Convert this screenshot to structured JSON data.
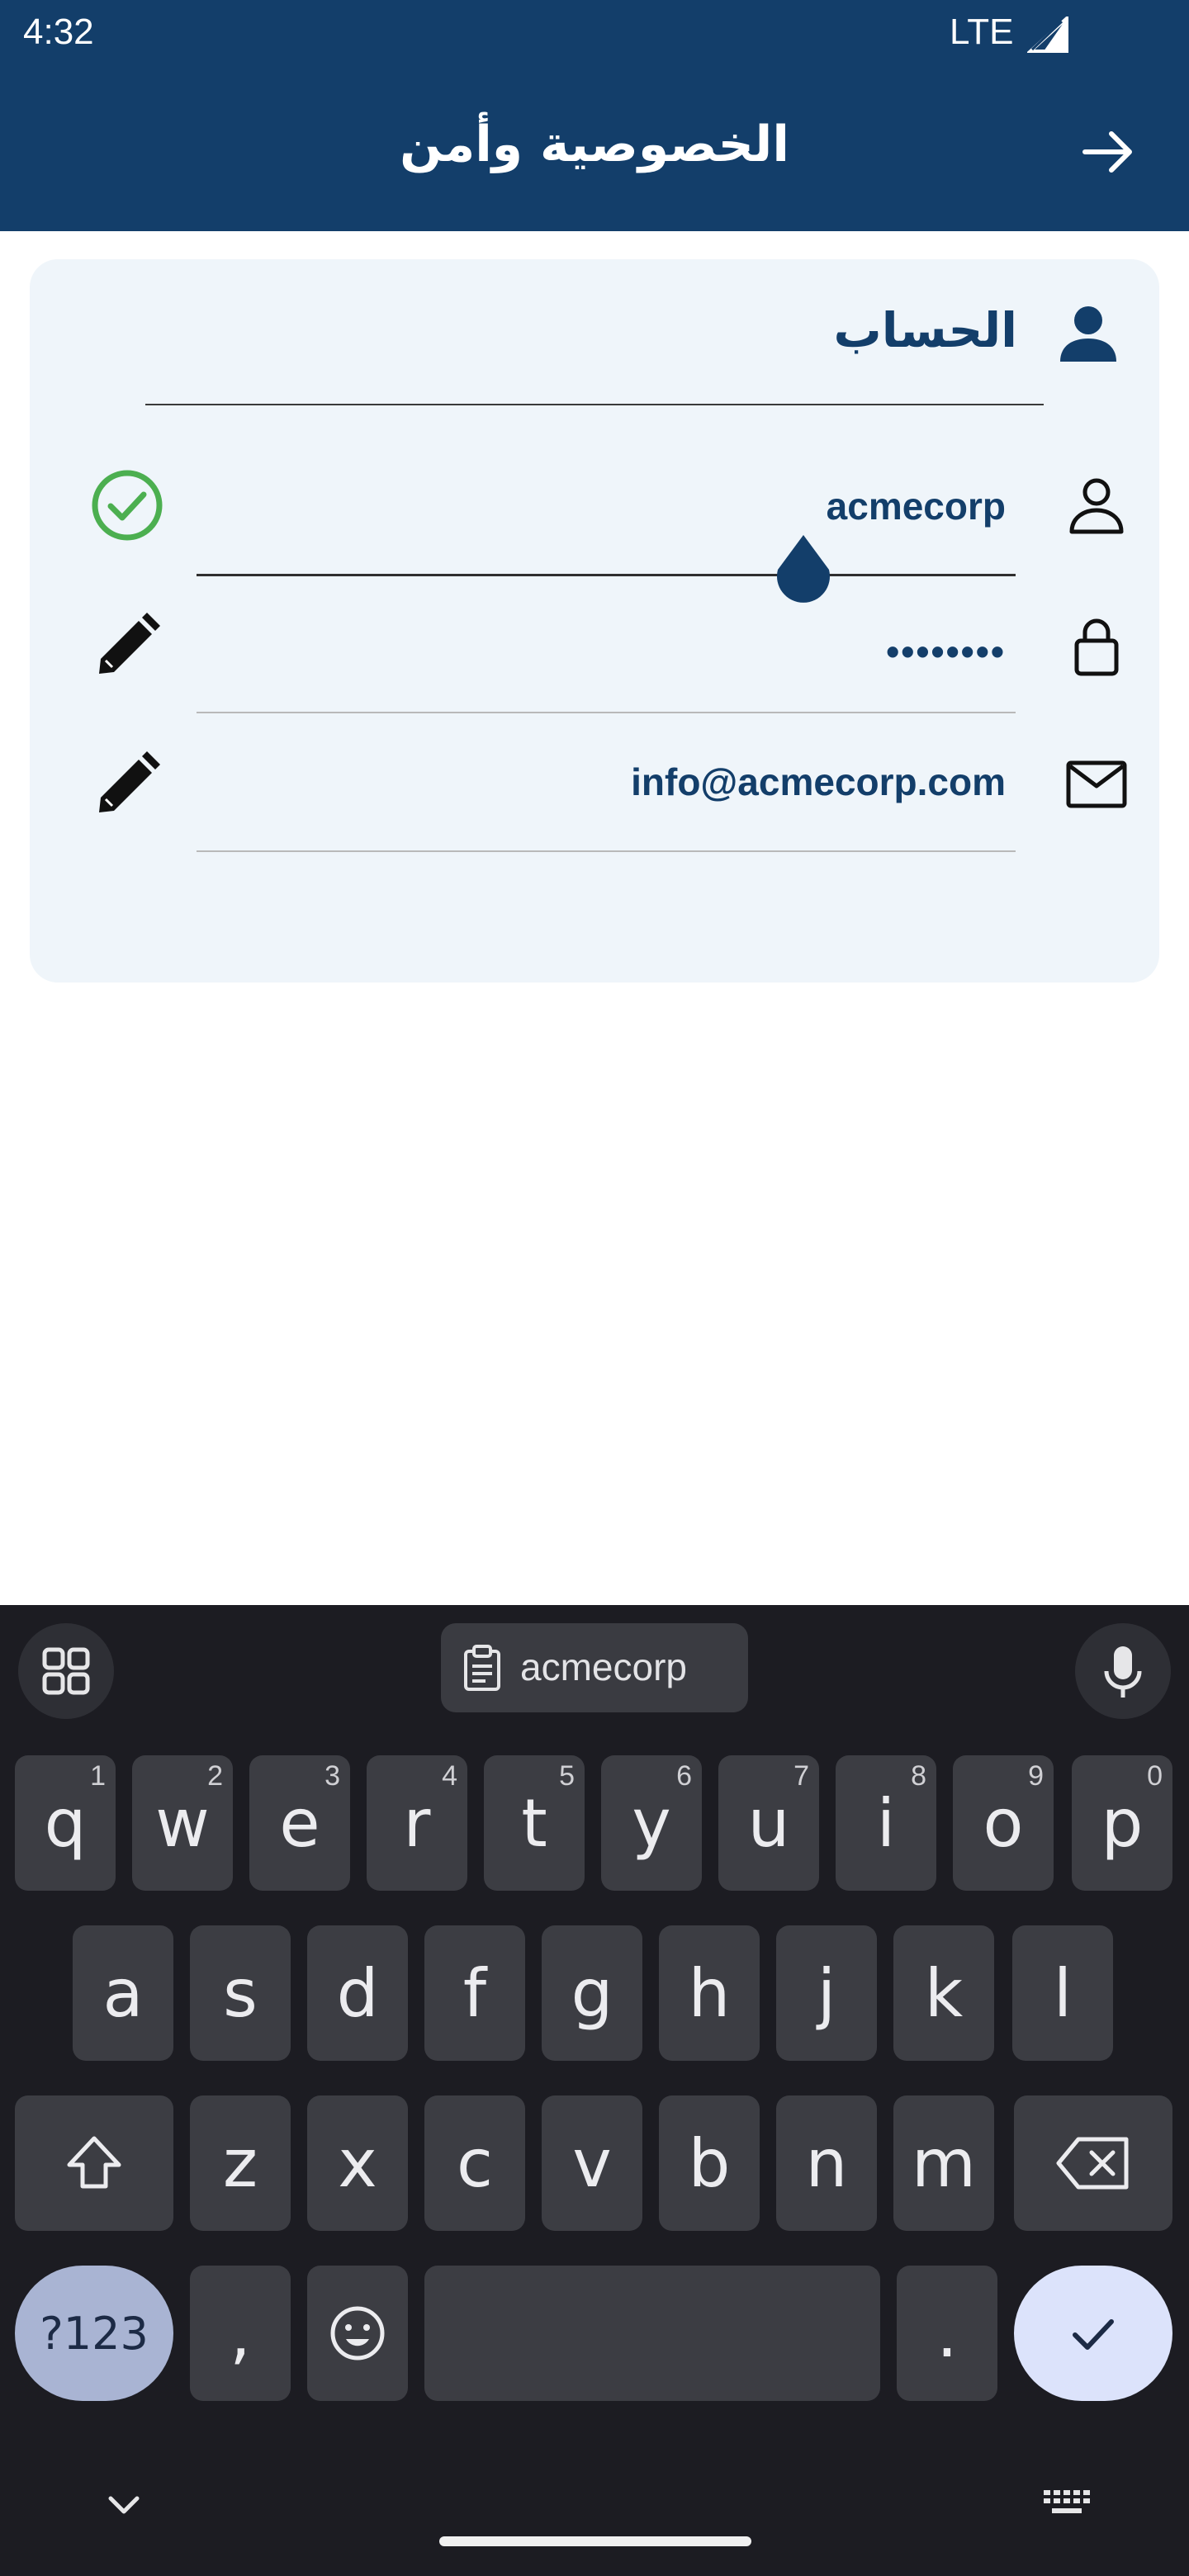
{
  "status_bar": {
    "time": "4:32",
    "network": "LTE"
  },
  "header": {
    "title": "الخصوصية وأمن"
  },
  "account": {
    "section_title": "الحساب",
    "username": "acmecorp",
    "password_masked": "••••••••",
    "email": "info@acmecorp.com"
  },
  "keyboard": {
    "clipboard_suggestion": "acmecorp",
    "row1": [
      {
        "key": "q",
        "hint": "1"
      },
      {
        "key": "w",
        "hint": "2"
      },
      {
        "key": "e",
        "hint": "3"
      },
      {
        "key": "r",
        "hint": "4"
      },
      {
        "key": "t",
        "hint": "5"
      },
      {
        "key": "y",
        "hint": "6"
      },
      {
        "key": "u",
        "hint": "7"
      },
      {
        "key": "i",
        "hint": "8"
      },
      {
        "key": "o",
        "hint": "9"
      },
      {
        "key": "p",
        "hint": "0"
      }
    ],
    "row2": [
      "a",
      "s",
      "d",
      "f",
      "g",
      "h",
      "j",
      "k",
      "l"
    ],
    "row3": [
      "z",
      "x",
      "c",
      "v",
      "b",
      "n",
      "m"
    ],
    "symbols_label": "?123",
    "comma": ",",
    "period": "."
  },
  "colors": {
    "header_bg": "#133e6a",
    "card_bg": "#eff5fa",
    "accent_text": "#133e6a",
    "success_green": "#4caf50",
    "keyboard_bg": "#1c1c22",
    "enter_key": "#dce3fb",
    "symbols_key": "#a9b4d3"
  }
}
